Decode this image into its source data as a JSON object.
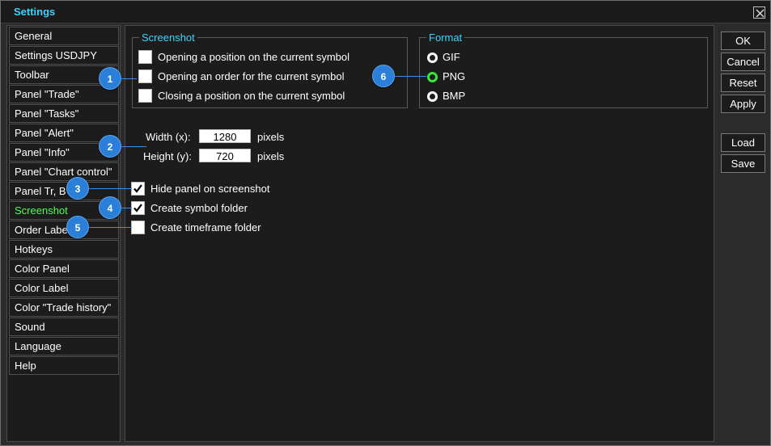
{
  "window": {
    "title": "Settings"
  },
  "sidebar": {
    "items": [
      {
        "label": "General",
        "active": false
      },
      {
        "label": "Settings USDJPY",
        "active": false
      },
      {
        "label": "Toolbar",
        "active": false
      },
      {
        "label": "Panel \"Trade\"",
        "active": false
      },
      {
        "label": "Panel \"Tasks\"",
        "active": false
      },
      {
        "label": "Panel \"Alert\"",
        "active": false
      },
      {
        "label": "Panel \"Info\"",
        "active": false
      },
      {
        "label": "Panel \"Chart control\"",
        "active": false
      },
      {
        "label": "Panel Tr, B",
        "active": false
      },
      {
        "label": "Screenshot",
        "active": true
      },
      {
        "label": "Order Labe",
        "active": false
      },
      {
        "label": "Hotkeys",
        "active": false
      },
      {
        "label": "Color Panel",
        "active": false
      },
      {
        "label": "Color Label",
        "active": false
      },
      {
        "label": "Color \"Trade history\"",
        "active": false
      },
      {
        "label": "Sound",
        "active": false
      },
      {
        "label": "Language",
        "active": false
      },
      {
        "label": "Help",
        "active": false
      }
    ]
  },
  "screenshot_group": {
    "title": "Screenshot",
    "options": [
      {
        "label": "Opening a position on the current symbol",
        "checked": false
      },
      {
        "label": "Opening an order for the current symbol",
        "checked": false
      },
      {
        "label": "Closing a position on the current symbol",
        "checked": false
      }
    ]
  },
  "format_group": {
    "title": "Format",
    "options": [
      {
        "label": "GIF",
        "selected": false
      },
      {
        "label": "PNG",
        "selected": true
      },
      {
        "label": "BMP",
        "selected": false
      }
    ]
  },
  "size": {
    "width_label": "Width (x):",
    "width_value": "1280",
    "height_label": "Height (y):",
    "height_value": "720",
    "unit": "pixels"
  },
  "options": [
    {
      "label": "Hide panel on screenshot",
      "checked": true
    },
    {
      "label": "Create symbol folder",
      "checked": true
    },
    {
      "label": "Create timeframe folder",
      "checked": false
    }
  ],
  "buttons": {
    "ok": "OK",
    "cancel": "Cancel",
    "reset": "Reset",
    "apply": "Apply",
    "load": "Load",
    "save": "Save"
  },
  "callouts": [
    "1",
    "2",
    "3",
    "4",
    "5",
    "6"
  ],
  "colors": {
    "accent": "#3fd1ff",
    "active": "#4dff4d",
    "callout": "#2b7fd9"
  }
}
